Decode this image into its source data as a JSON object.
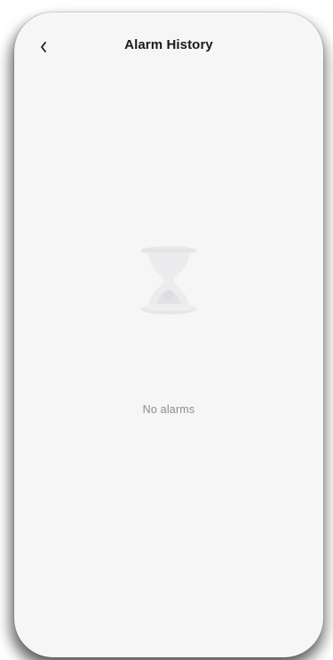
{
  "header": {
    "title": "Alarm History",
    "back_icon": "chevron-left-icon"
  },
  "empty_state": {
    "icon": "hourglass-icon",
    "message": "No alarms"
  },
  "colors": {
    "background": "#f6f6f6",
    "title": "#1a1a1a",
    "muted_text": "#8c8c8c",
    "icon": "#e6e6e8"
  }
}
